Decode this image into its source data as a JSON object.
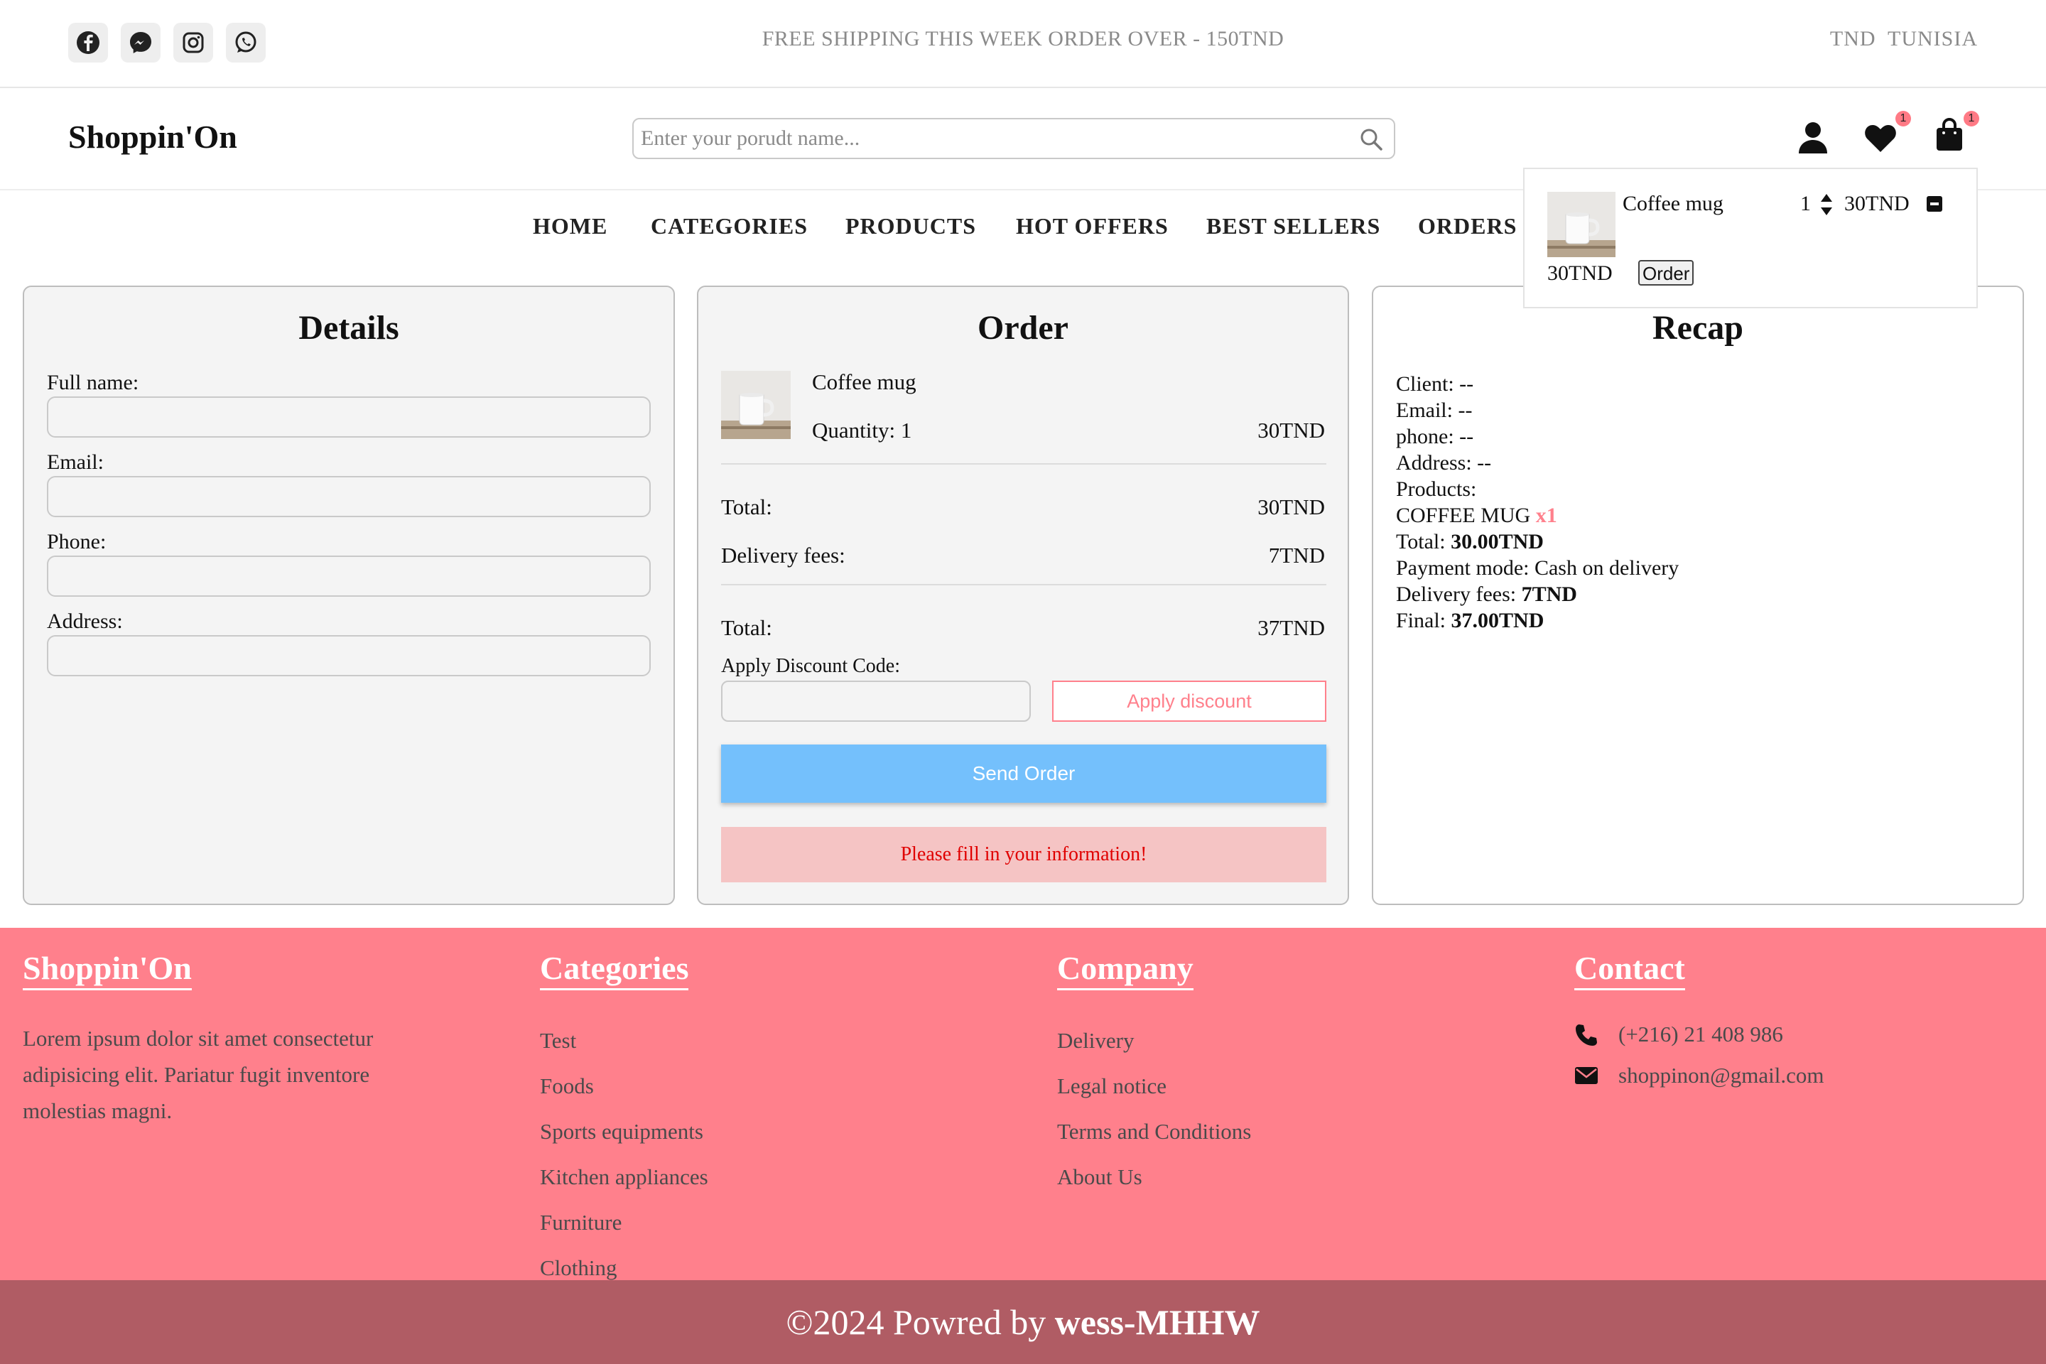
{
  "topbar": {
    "social": [
      {
        "icon": "facebook-icon"
      },
      {
        "icon": "messenger-icon"
      },
      {
        "icon": "instagram-icon"
      },
      {
        "icon": "whatsapp-icon"
      }
    ],
    "promo": "FREE SHIPPING THIS WEEK ORDER OVER - 150TND",
    "currency": "TND",
    "country": "TUNISIA"
  },
  "header": {
    "logo": "Shoppin'On",
    "search_placeholder": "Enter your porudt name...",
    "wishlist_count": "1",
    "cart_count": "1"
  },
  "nav": [
    "HOME",
    "CATEGORIES",
    "PRODUCTS",
    "HOT OFFERS",
    "BEST SELLERS",
    "ORDERS"
  ],
  "cart_dropdown": {
    "item_name": "Coffee mug",
    "quantity": "1",
    "price": "30TND",
    "total": "30TND",
    "order_button": "Order"
  },
  "details": {
    "title": "Details",
    "full_name_label": "Full name:",
    "email_label": "Email:",
    "phone_label": "Phone:",
    "address_label": "Address:"
  },
  "order": {
    "title": "Order",
    "item_name": "Coffee mug",
    "quantity_text": "Quantity: 1",
    "item_price": "30TND",
    "subtotal_label": "Total:",
    "subtotal_value": "30TND",
    "delivery_label": "Delivery fees:",
    "delivery_value": "7TND",
    "total_label": "Total:",
    "total_value": "37TND",
    "discount_label": "Apply Discount Code:",
    "apply_button": "Apply discount",
    "send_button": "Send Order",
    "warning": "Please fill in your information!"
  },
  "recap": {
    "title": "Recap",
    "client": "Client: --",
    "email": "Email: --",
    "phone": "phone: --",
    "address": "Address: --",
    "products_label": "Products:",
    "product_name": "COFFEE MUG",
    "product_qty": "x1",
    "total_label": "Total: ",
    "total_value": "30.00TND",
    "payment": "Payment mode: Cash on delivery",
    "delivery_label": "Delivery fees: ",
    "delivery_value": "7TND",
    "final_label": "Final: ",
    "final_value": "37.00TND"
  },
  "footer": {
    "brand_title": "Shoppin'On",
    "brand_text": [
      "Lorem ipsum dolor sit amet consectetur",
      "adipisicing elit. Pariatur fugit inventore",
      "molestias magni."
    ],
    "categories_title": "Categories",
    "categories": [
      "Test",
      "Foods",
      "Sports equipments",
      "Kitchen appliances",
      "Furniture",
      "Clothing"
    ],
    "company_title": "Company",
    "company": [
      "Delivery",
      "Legal notice",
      "Terms and Conditions",
      "About Us"
    ],
    "contact_title": "Contact",
    "phone": "(+216) 21 408 986",
    "email": "shoppinon@gmail.com",
    "copyright_prefix": "©2024 Powred by ",
    "copyright_author": "wess-MHHW"
  },
  "colors": {
    "accent_pink": "#ff808c",
    "footer_bottom": "#b05c64",
    "send_button": "#74c0fc",
    "warning_bg": "#f5c4c4",
    "warning_text": "#e00000"
  }
}
